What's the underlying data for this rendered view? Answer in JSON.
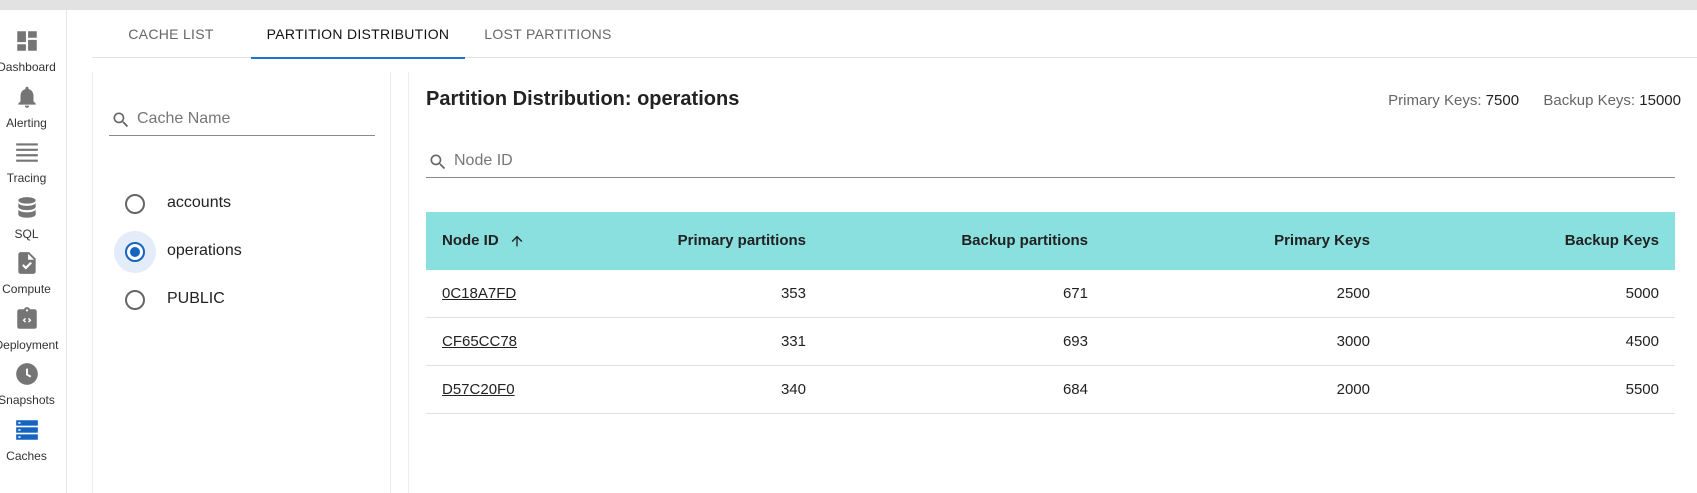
{
  "nav": {
    "items": [
      {
        "label": "Dashboard",
        "icon": "dashboard-icon"
      },
      {
        "label": "Alerting",
        "icon": "bell-icon"
      },
      {
        "label": "Tracing",
        "icon": "tracing-icon"
      },
      {
        "label": "SQL",
        "icon": "database-icon"
      },
      {
        "label": "Compute",
        "icon": "compute-icon"
      },
      {
        "label": "Deployment",
        "icon": "deployment-icon"
      },
      {
        "label": "Snapshots",
        "icon": "clock-icon"
      },
      {
        "label": "Caches",
        "icon": "caches-icon"
      }
    ],
    "active": "Caches",
    "icon_color": "#757575",
    "active_color": "#1565c0"
  },
  "tabs": [
    {
      "label": "CACHE LIST",
      "active": false
    },
    {
      "label": "PARTITION DISTRIBUTION",
      "active": true
    },
    {
      "label": "LOST PARTITIONS",
      "active": false
    }
  ],
  "cache_search": {
    "placeholder": "Cache Name",
    "value": ""
  },
  "caches": [
    {
      "label": "accounts",
      "selected": false
    },
    {
      "label": "operations",
      "selected": true
    },
    {
      "label": "PUBLIC",
      "selected": false
    }
  ],
  "main": {
    "title": "Partition Distribution: operations",
    "primary_keys_label": "Primary Keys:",
    "primary_keys_value": "7500",
    "backup_keys_label": "Backup Keys:",
    "backup_keys_value": "15000",
    "node_search": {
      "placeholder": "Node ID",
      "value": ""
    }
  },
  "table": {
    "header_color": "#8adfdf",
    "columns": [
      "Node ID",
      "Primary partitions",
      "Backup partitions",
      "Primary Keys",
      "Backup Keys"
    ],
    "sort": {
      "column": "Node ID",
      "direction": "ascending",
      "icon": "arrow-up-icon"
    },
    "rows": [
      [
        "0C18A7FD",
        "353",
        "671",
        "2500",
        "5000"
      ],
      [
        "CF65CC78",
        "331",
        "693",
        "3000",
        "4500"
      ],
      [
        "D57C20F0",
        "340",
        "684",
        "2000",
        "5500"
      ]
    ]
  }
}
